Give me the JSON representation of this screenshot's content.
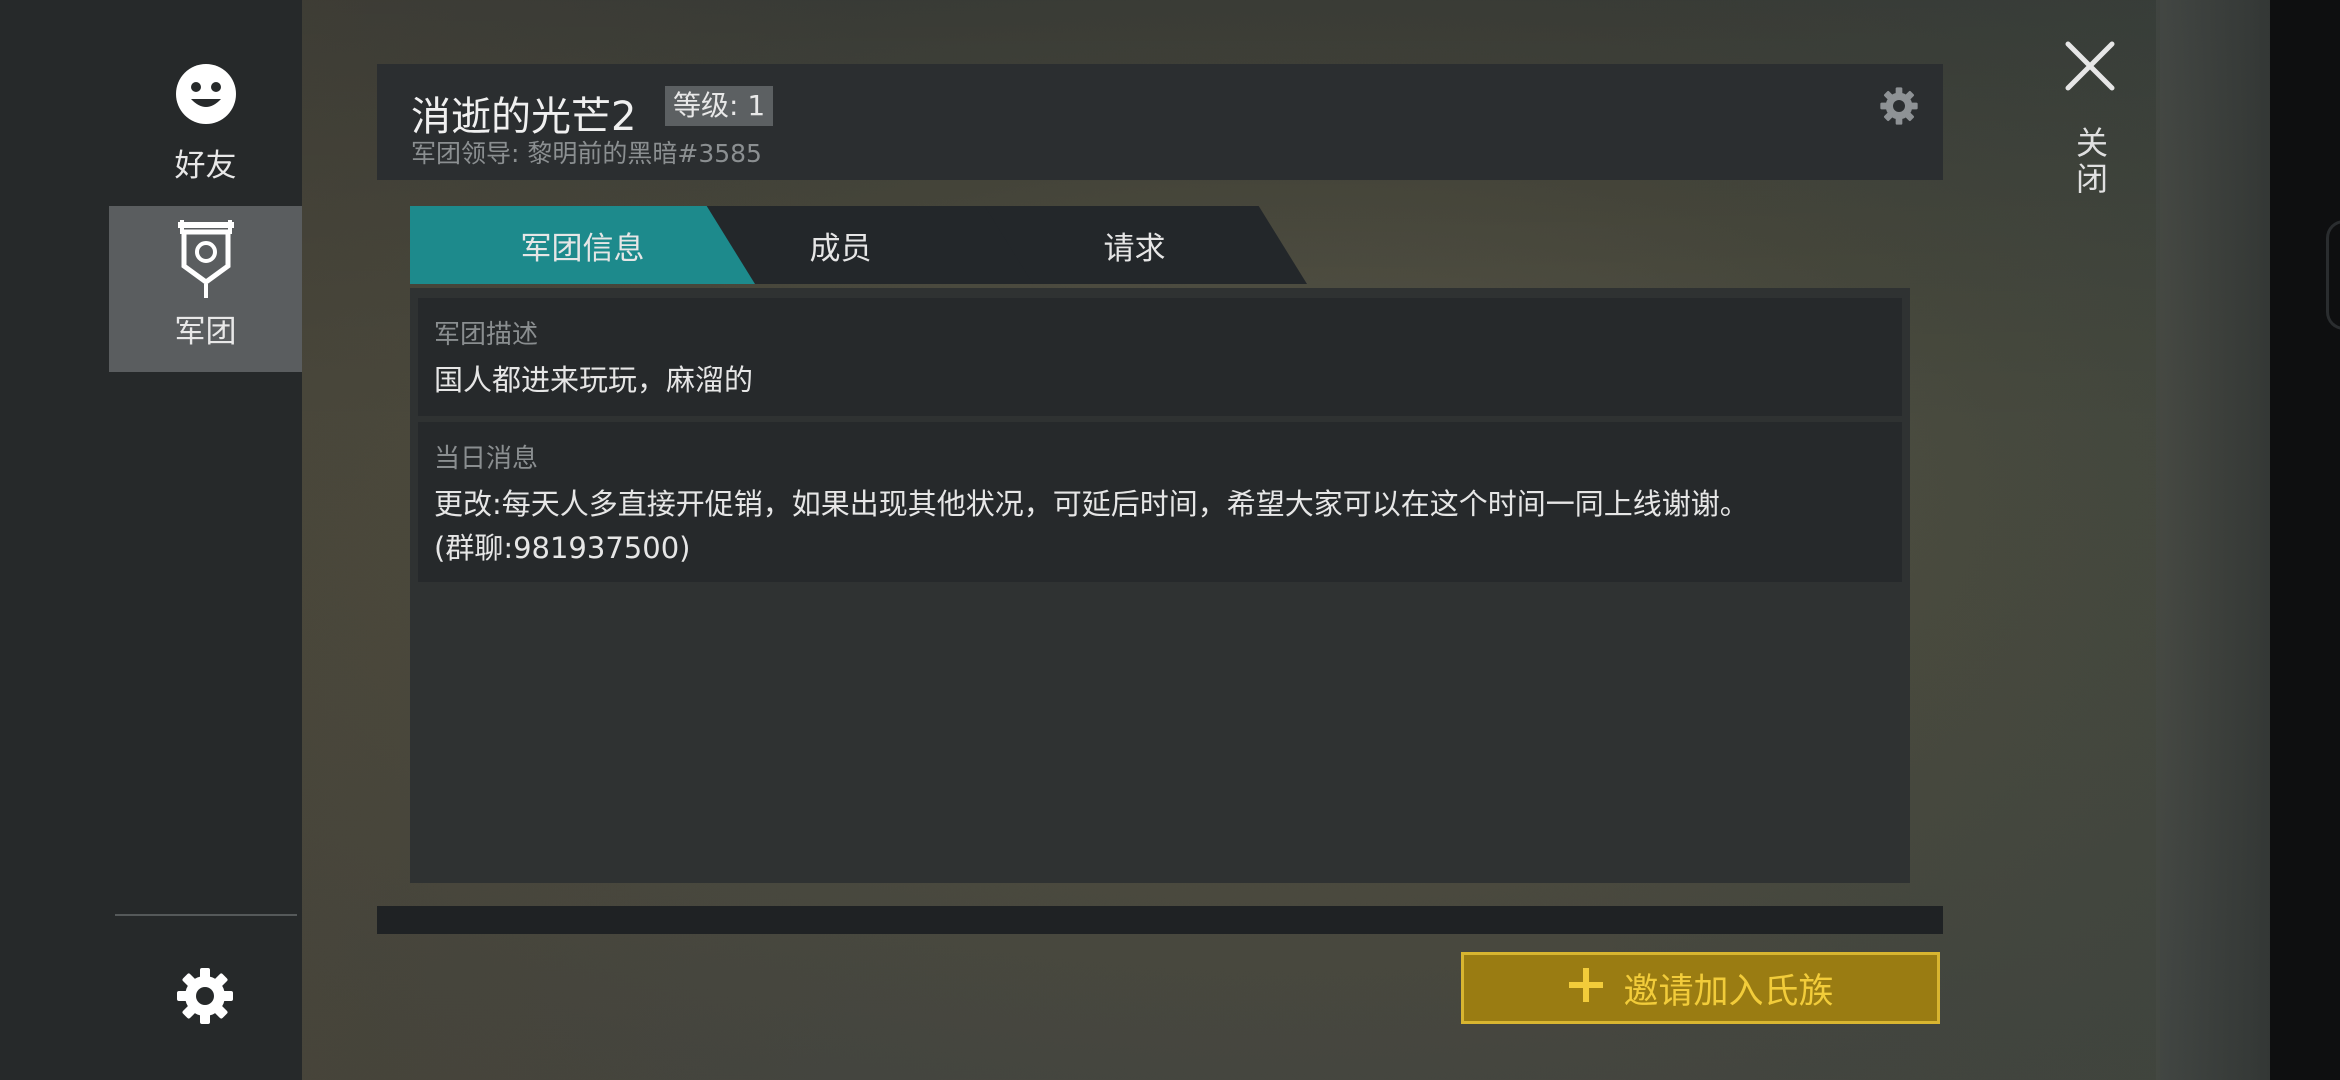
{
  "sidebar": {
    "friends_label": "好友",
    "clan_label": "军团"
  },
  "close": {
    "label": "关闭"
  },
  "header": {
    "clan_name": "消逝的光芒2",
    "level_badge": "等级: 1",
    "leader_line": "军团领导: 黎明前的黑暗#3585"
  },
  "tabs": [
    {
      "label": "军团信息",
      "active": true
    },
    {
      "label": "成员",
      "active": false
    },
    {
      "label": "请求",
      "active": false
    }
  ],
  "description": {
    "title": "军团描述",
    "text": "国人都进来玩玩，麻溜的"
  },
  "motd": {
    "title": "当日消息",
    "line1": "更改:每天人多直接开促销，如果出现其他状况，可延后时间，希望大家可以在这个时间一同上线谢谢。",
    "line2": "(群聊:981937500)"
  },
  "invite_button": {
    "label": "邀请加入氏族"
  },
  "colors": {
    "active_tab": "#1d8a8c",
    "invite_bg": "#9a7c12",
    "invite_text": "#f2cc3a"
  }
}
